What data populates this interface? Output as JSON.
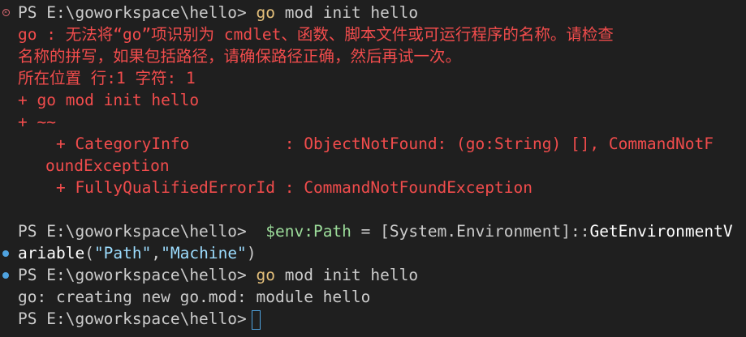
{
  "terminal": {
    "prompt": "PS E:\\goworkspace\\hello>",
    "first_cmd_name": "go",
    "first_cmd_args": " mod init hello",
    "error": {
      "line1": "go : 无法将“go”项识别为 cmdlet、函数、脚本文件或可运行程序的名称。请检查",
      "line2": "名称的拼写，如果包括路径，请确保路径正确，然后再试一次。",
      "line3": "所在位置 行:1 字符: 1",
      "line4": "+ go mod init hello",
      "line5": "+ ~~",
      "line6": "    + CategoryInfo          : ObjectNotFound: (go:String) [], CommandNotF",
      "line7": "oundException",
      "line8": "    + FullyQualifiedErrorId : CommandNotFoundException"
    },
    "env_cmd": {
      "var": "$env:Path",
      "assign": " = ",
      "type": "[System.Environment]",
      "sep": "::",
      "method_a": "GetEnvironmentV",
      "method_b": "ariable",
      "paren_open": "(",
      "arg1": "\"Path\"",
      "comma": ",",
      "arg2": "\"Machine\"",
      "paren_close": ")"
    },
    "second_cmd_name": "go",
    "second_cmd_args": " mod init hello",
    "output": "go: creating new go.mod: module hello"
  }
}
